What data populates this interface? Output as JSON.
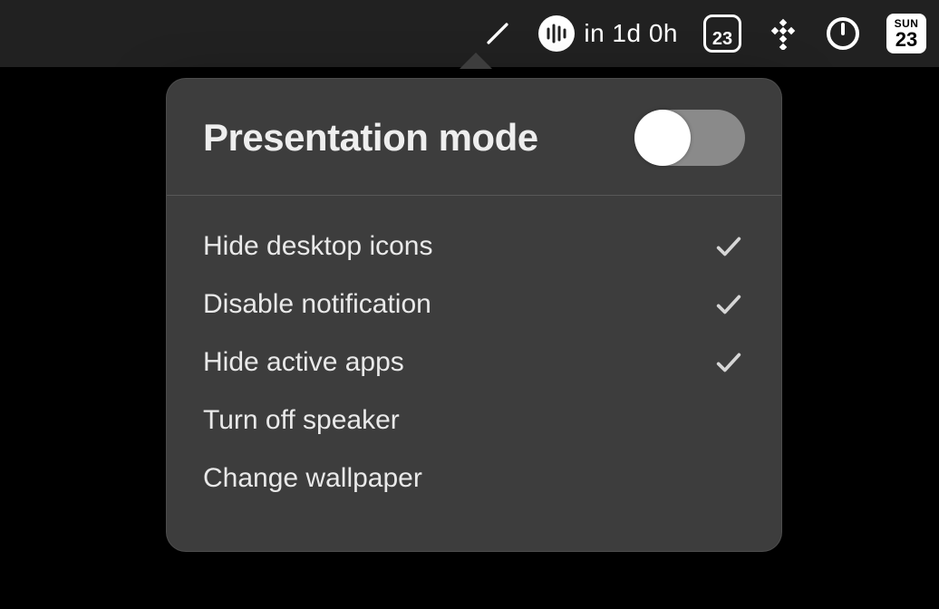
{
  "menubar": {
    "sound_label": "in 1d 0h",
    "calendar_day_number": "23",
    "day_badge": {
      "dow": "SUN",
      "num": "23"
    }
  },
  "popover": {
    "title": "Presentation mode",
    "toggle_on": false,
    "items": [
      {
        "label": "Hide desktop icons",
        "checked": true
      },
      {
        "label": "Disable notification",
        "checked": true
      },
      {
        "label": "Hide active apps",
        "checked": true
      },
      {
        "label": "Turn off speaker",
        "checked": false
      },
      {
        "label": "Change wallpaper",
        "checked": false
      }
    ]
  }
}
